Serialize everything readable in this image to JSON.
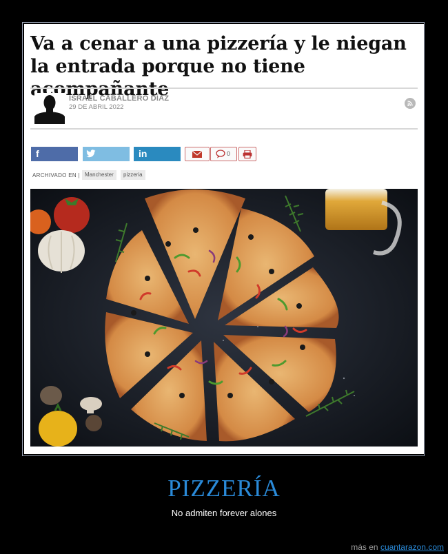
{
  "article": {
    "headline": "Va a cenar a una pizzería y le niegan la entrada porque no tiene acompañante",
    "author": "ISRAEL CABALLERO DÍAZ",
    "date": "29 DE ABRIL 2022",
    "comment_count": "0",
    "archived_label": "ARCHIVADO EN |",
    "tags": [
      "Manchester",
      "pizzeria"
    ],
    "share": {
      "facebook_icon": "f",
      "twitter_icon": "twitter-icon",
      "linkedin_icon": "in"
    },
    "colors": {
      "facebook": "#4e6ca8",
      "twitter": "#7fbde2",
      "linkedin": "#2a8abf",
      "tool_border": "#cc6b6b"
    }
  },
  "caption": {
    "title": "PIZZERÍA",
    "subtitle": "No admiten forever alones",
    "accent": "#2a8ad8"
  },
  "footer": {
    "prefix": "más en",
    "link": "cuantarazon.com"
  }
}
